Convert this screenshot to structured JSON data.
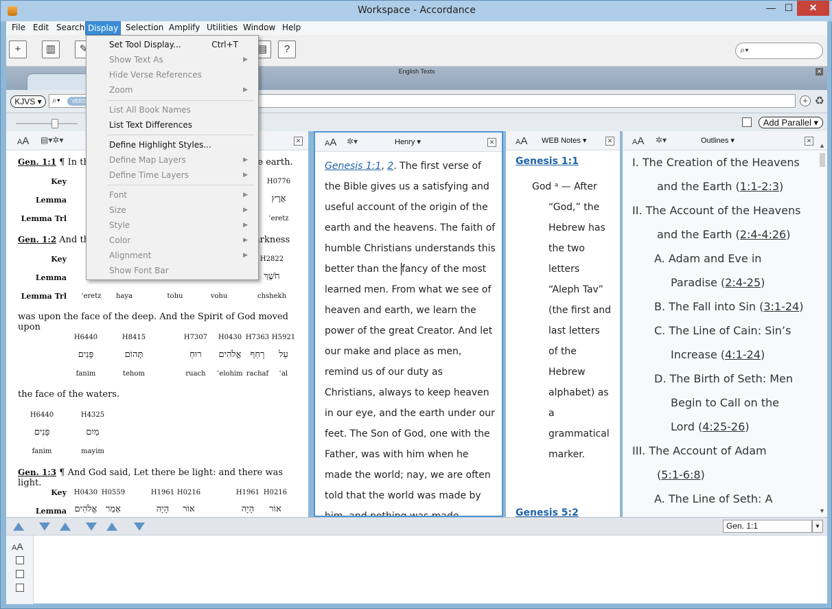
{
  "window": {
    "title": "Workspace - Accordance",
    "minimize": "—",
    "maximize": "☐",
    "close": "✕"
  },
  "menubar": [
    "File",
    "Edit",
    "Search",
    "Display",
    "Selection",
    "Amplify",
    "Utilities",
    "Window",
    "Help"
  ],
  "toolbar": {
    "help_glyph": "?"
  },
  "tabstrip": {
    "label": "English Texts"
  },
  "search": {
    "module": "KJVS ▾",
    "verses_badge": "VERS"
  },
  "slider_value": 0.6,
  "add_parallel": "Add Parallel ▾",
  "dropdown": {
    "items": [
      {
        "label": "Set Tool Display...",
        "shortcut": "Ctrl+T",
        "enabled": true
      },
      {
        "label": "Show Text As",
        "enabled": false,
        "submenu": true
      },
      {
        "label": "Hide Verse References",
        "enabled": false
      },
      {
        "label": "Zoom",
        "enabled": false,
        "submenu": true
      },
      {
        "label": "List All Book Names",
        "enabled": false
      },
      {
        "label": "List Text Differences",
        "enabled": true
      },
      {
        "label": "Define Highlight Styles...",
        "enabled": true
      },
      {
        "label": "Define Map Layers",
        "enabled": false,
        "submenu": true
      },
      {
        "label": "Define Time Layers",
        "enabled": false,
        "submenu": true
      },
      {
        "label": "Font",
        "enabled": false,
        "submenu": true
      },
      {
        "label": "Size",
        "enabled": false,
        "submenu": true
      },
      {
        "label": "Style",
        "enabled": false,
        "submenu": true
      },
      {
        "label": "Color",
        "enabled": false,
        "submenu": true
      },
      {
        "label": "Alignment",
        "enabled": false,
        "submenu": true
      },
      {
        "label": "Show Font Bar",
        "enabled": false
      }
    ]
  },
  "pane1": {
    "v1_ref": "Gen. 1:1",
    "v1_text": "¶ In the",
    "v1_tail": "he earth.",
    "label_key": "Key",
    "label_lemma": "Lemma",
    "label_lemma_trl": "Lemma Trl",
    "v1_key_right": "H0776",
    "v1_lemma_right": "אֶרֶץ",
    "v1_trl_right": "ʾeretz",
    "v2_ref": "Gen. 1:2",
    "v2_text": "And the",
    "v2_tail": "arkness",
    "v2_key_right": "H2822",
    "v2_lemma_right": "חֹשֶׁךְ",
    "v2_trl": [
      "ʾeretz",
      "haya",
      "tohu",
      "vohu",
      "chshekh"
    ],
    "v2_cont": "was upon the face of the deep. And the Spirit of God moved upon",
    "row3_keys": [
      "H6440",
      "H8415",
      "H7307",
      "H0430",
      "H7363",
      "H5921"
    ],
    "row3_heb": [
      "פָּנִים",
      "תְּהוֹם",
      "רוּחַ",
      "אֱלֹהִים",
      "רָחַף",
      "עַל"
    ],
    "row3_trl": [
      "fanim",
      "tehom",
      "ruach",
      "ʾelohim",
      "rachaf",
      "ʿal"
    ],
    "line_waters": "the face of the waters.",
    "row4_keys": [
      "H6440",
      "H4325"
    ],
    "row4_heb": [
      "פָּנִים",
      "מַיִם"
    ],
    "row4_trl": [
      "fanim",
      "mayim"
    ],
    "v3_ref": "Gen. 1:3",
    "v3_text": "¶ And God said, Let there be light: and there was light.",
    "v3_keys": [
      "H0430",
      "H0559",
      "H1961",
      "H0216",
      "H1961",
      "H0216"
    ],
    "v3_heb": [
      "אֱלֹהִים",
      "אָמַר",
      "הָיָה",
      "אוֹר",
      "הָיָה",
      "אוֹר"
    ]
  },
  "pane2": {
    "title": "Henry ▾",
    "link1": "Genesis 1:1",
    "link2": "2",
    "text_a": ". The first verse of the Bible gives us a satisfying and useful account of the origin of the earth and the heavens. The faith of humble Christians understands this better than the ",
    "text_b": "fancy of the most learned men. From what we see of heaven and earth, we learn the power of the great Creator. And let our make and place as men, remind us of our duty as Christians, always to keep heaven in our eye, and the earth under our feet. The Son of God, one with the Father, was with him when he made the world; nay, we are often told that the world was made by him, and nothing was made"
  },
  "pane3": {
    "title": "WEB Notes ▾",
    "ref1": "Genesis 1:1",
    "note_first": "God ᵃ — After",
    "note_rest": "“God,” the Hebrew has the two letters “Aleph Tav” (the first and last letters of the Hebrew alphabet) as a grammatical marker.",
    "ref2": "Genesis 5:2"
  },
  "pane4": {
    "title": "Outlines ▾",
    "lines": [
      {
        "text": "I. The Creation of the Heavens",
        "ref": ""
      },
      {
        "text": "and the Earth (",
        "ref": "1:1-2:3",
        "close": ")"
      },
      {
        "text": "II. The Account of the Heavens",
        "ref": ""
      },
      {
        "text": "and the Earth (",
        "ref": "2:4-4:26",
        "close": ")"
      },
      {
        "text": "A. Adam and Eve in",
        "ref": ""
      },
      {
        "text": "Paradise (",
        "ref": "2:4-25",
        "close": ")"
      },
      {
        "text": "B. The Fall into Sin (",
        "ref": "3:1-24",
        "close": ")"
      },
      {
        "text": "C. The Line of Cain: Sin’s",
        "ref": ""
      },
      {
        "text": "Increase (",
        "ref": "4:1-24",
        "close": ")"
      },
      {
        "text": "D. The Birth of Seth: Men",
        "ref": ""
      },
      {
        "text": "Begin to Call on the",
        "ref": ""
      },
      {
        "text": "Lord (",
        "ref": "4:25-26",
        "close": ")"
      },
      {
        "text": "III. The Account of Adam",
        "ref": ""
      },
      {
        "text": "(",
        "ref": "5:1-6:8",
        "close": ")"
      },
      {
        "text": "A. The Line of Seth: A",
        "ref": ""
      }
    ]
  },
  "navrow": {
    "reference": "Gen. 1:1"
  }
}
